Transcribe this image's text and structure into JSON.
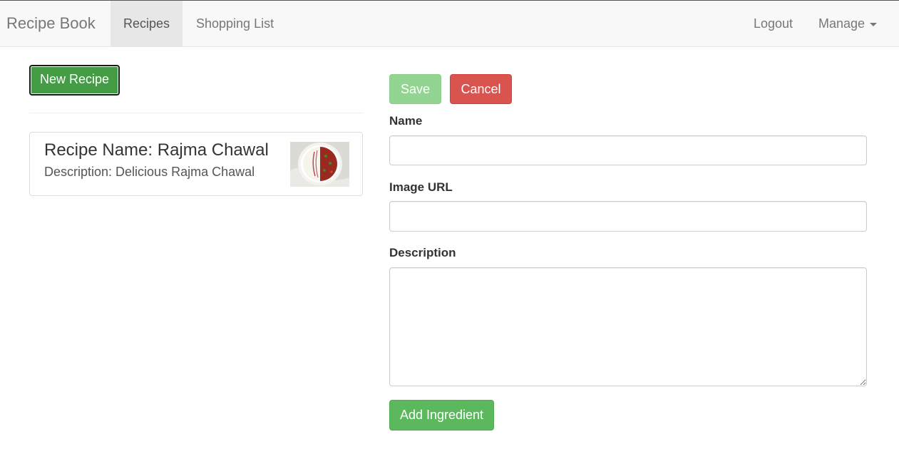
{
  "navbar": {
    "brand": "Recipe Book",
    "items": [
      {
        "label": "Recipes",
        "active": true
      },
      {
        "label": "Shopping List",
        "active": false
      }
    ],
    "right_items": [
      {
        "label": "Logout"
      },
      {
        "label": "Manage",
        "has_dropdown": true
      }
    ]
  },
  "recipes": {
    "new_button_label": "New Recipe",
    "list": [
      {
        "name": "Recipe Name: Rajma Chawal",
        "description": "Description: Delicious Rajma Chawal",
        "image_icon": "rajma-chawal-photo"
      }
    ]
  },
  "editor": {
    "save_label": "Save",
    "cancel_label": "Cancel",
    "name_label": "Name",
    "name_value": "",
    "image_url_label": "Image URL",
    "image_url_value": "",
    "description_label": "Description",
    "description_value": "",
    "add_ingredient_label": "Add Ingredient"
  },
  "colors": {
    "success": "#5cb85c",
    "success_disabled": "#92d492",
    "danger": "#d9534f",
    "navbar_bg": "#f8f8f8",
    "navbar_active": "#e7e7e7"
  }
}
